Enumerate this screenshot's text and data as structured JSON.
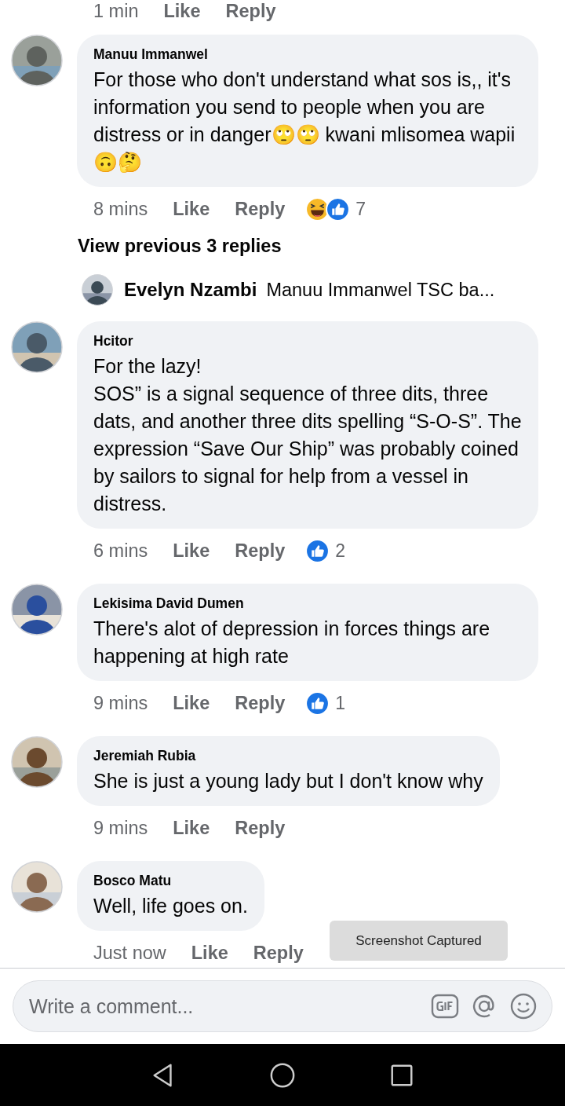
{
  "top_meta": {
    "time": "1 min",
    "like": "Like",
    "reply": "Reply"
  },
  "comments": [
    {
      "kind": "comment",
      "author": "Manuu Immanwel",
      "text": "For those who don't understand what sos is,, it's information you send to people when you are distress or in danger🙄🙄 kwani mlisomea wapii🙃🤔",
      "time": "8 mins",
      "like": "Like",
      "reply": "Reply",
      "reactions": [
        {
          "kind": "haha"
        },
        {
          "kind": "like"
        }
      ],
      "count": "7",
      "avatar": {
        "kind": "picture"
      }
    },
    {
      "kind": "replies",
      "link": "View previous 3 replies",
      "author": "Evelyn Nzambi",
      "text": "Manuu Immanwel TSC ba...",
      "avatar": {
        "kind": "picture"
      }
    },
    {
      "kind": "comment",
      "author": "Hcitor",
      "text": "For the lazy!\nSOS” is a signal sequence of three dits, three dats, and another three dits spelling “S-O-S”. The expression “Save Our Ship” was probably coined by sailors to signal for help from a vessel in distress.",
      "time": "6 mins",
      "like": "Like",
      "reply": "Reply",
      "reactions": [
        {
          "kind": "like"
        }
      ],
      "count": "2",
      "avatar": {
        "kind": "picture"
      }
    },
    {
      "kind": "comment",
      "author": "Lekisima David Dumen",
      "text": "There's alot of depression in forces things are happening at high rate",
      "time": "9 mins",
      "like": "Like",
      "reply": "Reply",
      "reactions": [
        {
          "kind": "like"
        }
      ],
      "count": "1",
      "avatar": {
        "kind": "picture"
      }
    },
    {
      "kind": "comment",
      "author": "Jeremiah Rubia",
      "text": "She is just a young lady but I don't know why",
      "time": "9 mins",
      "like": "Like",
      "reply": "Reply",
      "avatar": {
        "kind": "picture"
      }
    },
    {
      "kind": "comment",
      "author": "Bosco Matu",
      "text": "Well, life goes on.",
      "time": "Just now",
      "like": "Like",
      "reply": "Reply",
      "avatar": {
        "kind": "picture"
      }
    }
  ],
  "toast": "Screenshot Captured",
  "composer": {
    "placeholder": "Write a comment..."
  }
}
